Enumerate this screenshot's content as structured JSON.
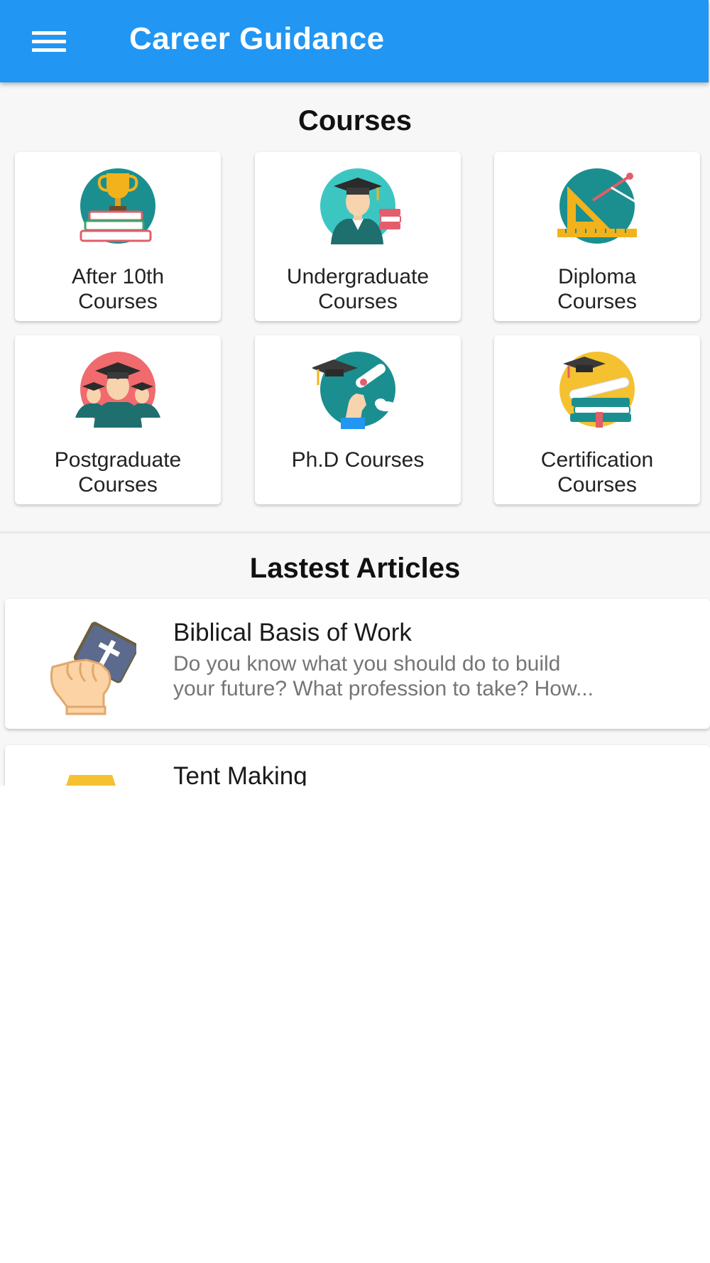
{
  "app_bar": {
    "title": "Career Guidance",
    "menu_icon": "hamburger-menu-icon",
    "color": "#2196f3"
  },
  "courses": {
    "section_title": "Courses",
    "items": [
      {
        "label_line1": "After 10th",
        "label_line2": "Courses",
        "icon": "trophy-books-icon"
      },
      {
        "label_line1": "Undergraduate",
        "label_line2": "Courses",
        "icon": "graduate-student-icon"
      },
      {
        "label_line1": "Diploma",
        "label_line2": "Courses",
        "icon": "ruler-compass-icon"
      },
      {
        "label_line1": "Postgraduate",
        "label_line2": "Courses",
        "icon": "graduates-group-icon"
      },
      {
        "label_line1": "Ph.D Courses",
        "label_line2": "",
        "icon": "diploma-scroll-icon"
      },
      {
        "label_line1": "Certification",
        "label_line2": "Courses",
        "icon": "certificate-books-icon"
      }
    ]
  },
  "articles": {
    "section_title": "Lastest Articles",
    "items": [
      {
        "title": "Biblical Basis of Work",
        "description_line1": "Do you know what you should do to build",
        "description_line2": "your future? What profession to take? How...",
        "icon": "hand-holding-bible-icon"
      },
      {
        "title": "Tent Making",
        "icon": "tent-icon"
      }
    ]
  }
}
